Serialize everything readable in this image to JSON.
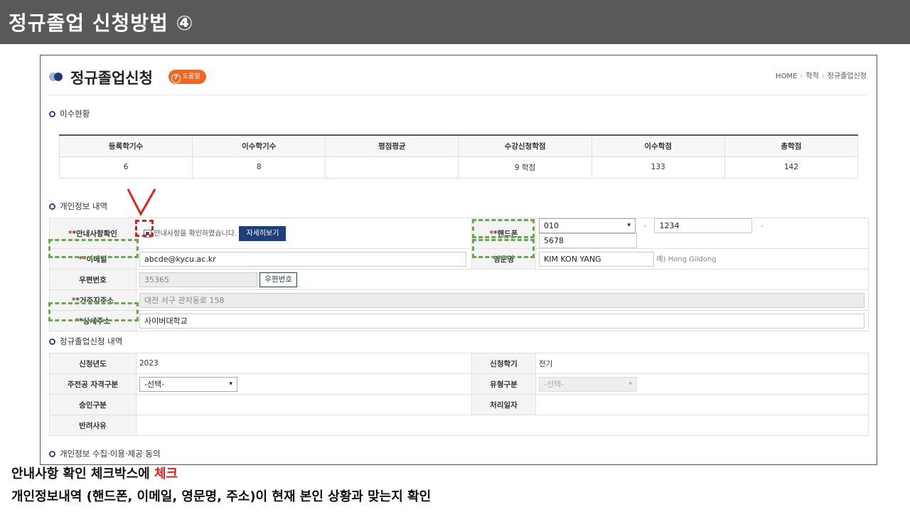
{
  "slide_title": "정규졸업 신청방법 ④",
  "header": {
    "title": "정규졸업신청",
    "help_label": "도움말",
    "breadcrumb": [
      "HOME",
      "학적",
      "정규졸업신청"
    ]
  },
  "sections": {
    "course_status": "이수현황",
    "personal_info": "개인정보 내역",
    "graduation_history": "정규졸업신청 내역",
    "consent": "개인정보 수집·이용·제공 동의"
  },
  "summary_table": {
    "headers": [
      "등록학기수",
      "이수학기수",
      "평점평균",
      "수강신청학점",
      "이수학점",
      "총학점"
    ],
    "values": [
      "6",
      "8",
      "",
      "9 학점",
      "133",
      "142"
    ]
  },
  "personal": {
    "notice_label": "*안내사항확인",
    "notice_text": "안내사항을 확인하였습니다.",
    "detail_button": "자세히보기",
    "phone_label": "*핸드폰",
    "phone_prefix": "010",
    "phone_mid": "1234",
    "phone_last": "5678",
    "dash": "-",
    "email_label": "*이메일",
    "email_value": "abcde@kycu.ac.kr",
    "english_name_label": "영문명",
    "english_name_value": "KIM KON YANG",
    "english_name_hint": "예) Hong Gildong",
    "zip_label": "우편번호",
    "zip_value": "35365",
    "zip_button": "우편번호",
    "address_label": "*거주지주소",
    "address_value": "대전 서구 관저동로 158",
    "detail_address_label": "*상세주소",
    "detail_address_value": "사이버대학교"
  },
  "graduation": {
    "year_label": "신청년도",
    "year_value": "2023",
    "semester_label": "신청학기",
    "semester_value": "전기",
    "major_label": "주전공 자격구분",
    "major_value": "-선택-",
    "type_label": "유형구분",
    "type_value": "-선택-",
    "approval_label": "승인구분",
    "processed_label": "처리일자",
    "reject_label": "반려사유"
  },
  "captions": {
    "line1_prefix": "안내사항 확인 체크박스에 ",
    "line1_highlight": "체크",
    "line2": "개인정보내역 (핸드폰, 이메일, 영문명, 주소)이 현재 본인 상황과 맞는지 확인"
  },
  "colors": {
    "banner": "#595959",
    "accent_red": "#e02020",
    "highlight_green": "#6aa84f",
    "navy": "#1f3f7a",
    "help_orange": "#f26522"
  }
}
